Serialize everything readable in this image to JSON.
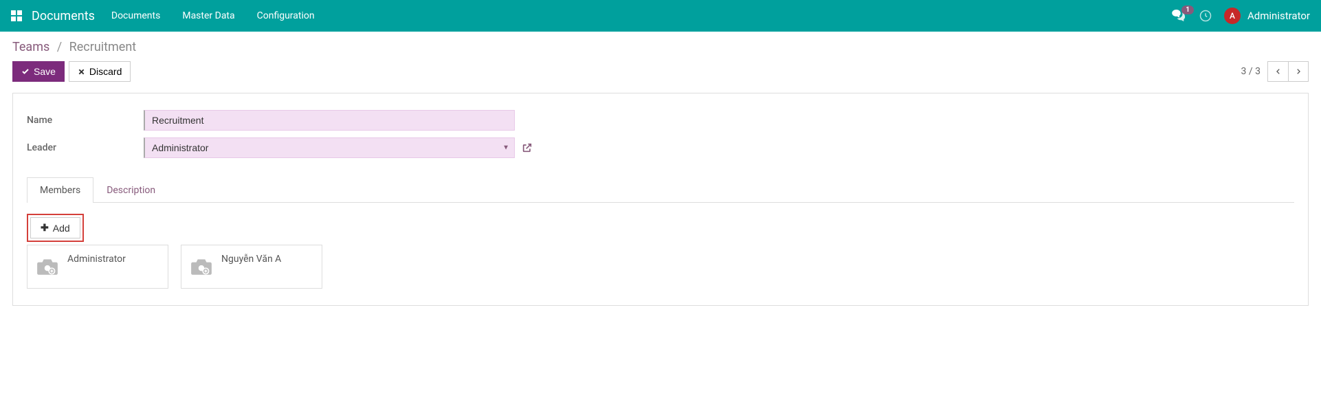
{
  "nav": {
    "brand": "Documents",
    "links": [
      "Documents",
      "Master Data",
      "Configuration"
    ],
    "badge_count": "1",
    "user_initial": "A",
    "username": "Administrator"
  },
  "breadcrumb": {
    "parent": "Teams",
    "current": "Recruitment"
  },
  "actions": {
    "save": "Save",
    "discard": "Discard"
  },
  "pager": {
    "text": "3 / 3"
  },
  "form": {
    "name_label": "Name",
    "name_value": "Recruitment",
    "leader_label": "Leader",
    "leader_value": "Administrator"
  },
  "tabs": {
    "members": "Members",
    "description": "Description"
  },
  "members": {
    "add_label": "Add",
    "cards": [
      {
        "name": "Administrator"
      },
      {
        "name": "Nguyễn Văn A"
      }
    ]
  }
}
